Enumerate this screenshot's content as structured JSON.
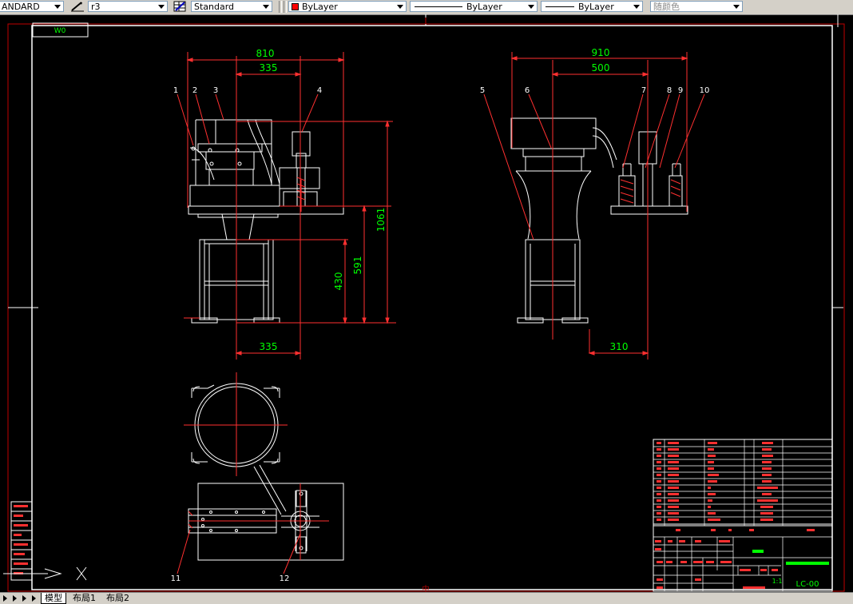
{
  "toolbar": {
    "text_style": "ANDARD",
    "dim_style": "r3",
    "table_style": "Standard",
    "color": "ByLayer",
    "color_swatch": "#ff0000",
    "linetype": "ByLayer",
    "lineweight": "ByLayer",
    "plot_style": "随颜色"
  },
  "drawing": {
    "title_box": "W0",
    "dims": {
      "front_width": "810",
      "front_center": "335",
      "front_bottom": "335",
      "front_height": "1061",
      "front_table": "591",
      "front_leg": "430",
      "side_width": "910",
      "side_center": "500",
      "side_offset": "310"
    },
    "callouts": [
      "1",
      "2",
      "3",
      "4",
      "5",
      "6",
      "7",
      "8",
      "9",
      "10",
      "11",
      "12"
    ],
    "drawing_no": "LC-00",
    "scale": "1:1",
    "sheet_marker": "中"
  },
  "tabs": {
    "model": "模型",
    "layout1": "布局1",
    "layout2": "布局2"
  }
}
